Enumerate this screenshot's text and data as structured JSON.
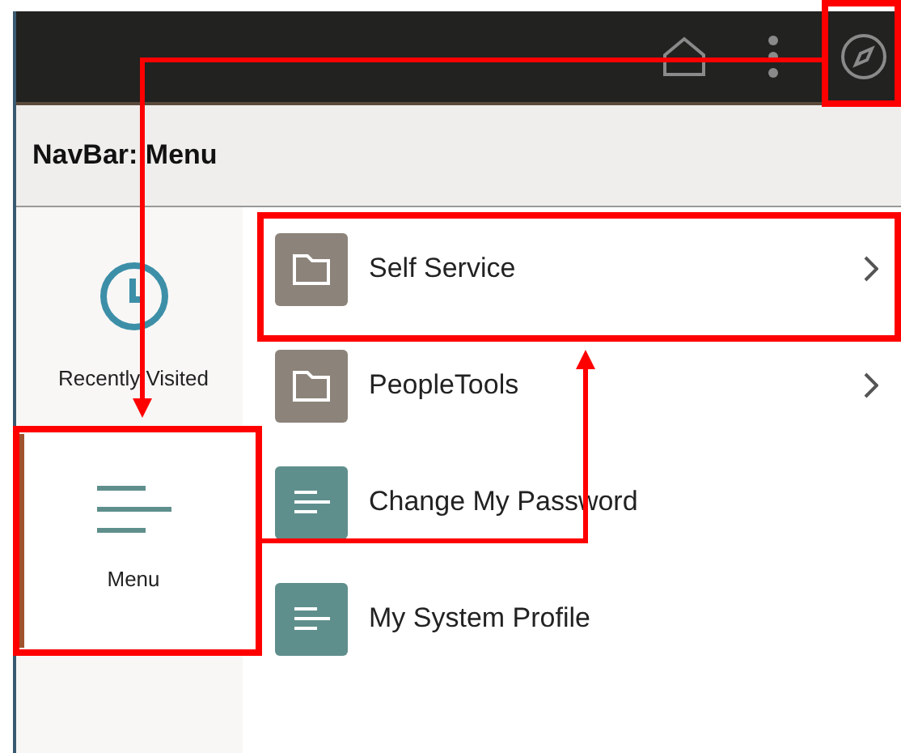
{
  "header": {
    "title": "NavBar: Menu"
  },
  "sidebar": {
    "items": [
      {
        "label": "Recently Visited",
        "kind": "clock",
        "selected": false
      },
      {
        "label": "Menu",
        "kind": "menu",
        "selected": true
      }
    ]
  },
  "menu": {
    "items": [
      {
        "label": "Self Service",
        "kind": "folder"
      },
      {
        "label": "PeopleTools",
        "kind": "folder"
      },
      {
        "label": "Change My Password",
        "kind": "page"
      },
      {
        "label": "My System Profile",
        "kind": "page"
      }
    ]
  }
}
